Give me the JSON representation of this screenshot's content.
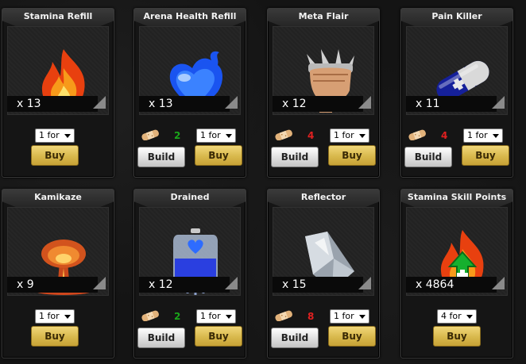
{
  "colors": {
    "cost_green": "#1aa51a",
    "cost_red": "#e02020",
    "buy_gold": "#d8b84c",
    "card_bg": "#151515"
  },
  "items": [
    {
      "title": "Stamina Refill",
      "quantity": "x 13",
      "icon": "flame-icon",
      "select": "1 for",
      "buy": "Buy"
    },
    {
      "title": "Arena Health Refill",
      "quantity": "x 13",
      "icon": "blue-heart-icon",
      "select": "1 for",
      "buy": "Buy",
      "build": "Build",
      "cost": "2",
      "cost_color": "green"
    },
    {
      "title": "Meta Flair",
      "quantity": "x 12",
      "icon": "spiked-fist-icon",
      "select": "1 for",
      "buy": "Buy",
      "build": "Build",
      "cost": "4",
      "cost_color": "red"
    },
    {
      "title": "Pain Killer",
      "quantity": "x 11",
      "icon": "pill-capsule-icon",
      "select": "1 for",
      "buy": "Buy",
      "build": "Build",
      "cost": "4",
      "cost_color": "red"
    },
    {
      "title": "Kamikaze",
      "quantity": "x 9",
      "icon": "mushroom-cloud-icon",
      "select": "1 for",
      "buy": "Buy"
    },
    {
      "title": "Drained",
      "quantity": "x 12",
      "icon": "iv-bag-icon",
      "select": "1 for",
      "buy": "Buy",
      "build": "Build",
      "cost": "2",
      "cost_color": "green"
    },
    {
      "title": "Reflector",
      "quantity": "x 15",
      "icon": "glass-shard-icon",
      "select": "1 for",
      "buy": "Buy",
      "build": "Build",
      "cost": "8",
      "cost_color": "red"
    },
    {
      "title": "Stamina Skill Points",
      "quantity": "x 4864",
      "icon": "flame-plus-icon",
      "select": "4 for",
      "buy": "Buy"
    }
  ]
}
